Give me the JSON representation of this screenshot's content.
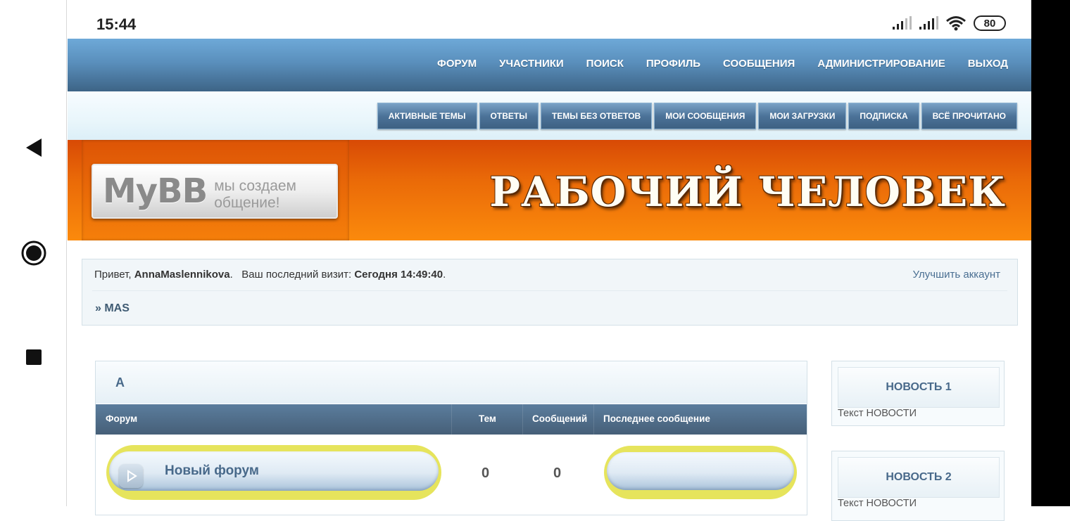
{
  "status_bar": {
    "time": "15:44",
    "battery": "80"
  },
  "main_nav": {
    "items": [
      {
        "label": "ФОРУМ"
      },
      {
        "label": "УЧАСТНИКИ"
      },
      {
        "label": "ПОИСК"
      },
      {
        "label": "ПРОФИЛЬ"
      },
      {
        "label": "СООБЩЕНИЯ"
      },
      {
        "label": "АДМИНИСТРИРОВАНИЕ"
      },
      {
        "label": "ВЫХОД"
      }
    ]
  },
  "sub_nav": {
    "items": [
      {
        "label": "АКТИВНЫЕ ТЕМЫ"
      },
      {
        "label": "ОТВЕТЫ"
      },
      {
        "label": "ТЕМЫ БЕЗ ОТВЕТОВ"
      },
      {
        "label": "МОИ СООБЩЕНИЯ"
      },
      {
        "label": "МОИ ЗАГРУЗКИ"
      },
      {
        "label": "ПОДПИСКА"
      },
      {
        "label": "ВСЁ ПРОЧИТАНО"
      }
    ]
  },
  "banner": {
    "logo_main": "MyBB",
    "logo_tagline": "мы создаем общение!",
    "site_title": "РАБОЧИЙ ЧЕЛОВЕК"
  },
  "welcome": {
    "greeting_prefix": "Привет, ",
    "username": "AnnaMaslennikova",
    "greeting_suffix": ".",
    "last_visit_label": "Ваш последний визит: ",
    "last_visit_value": "Сегодня 14:49:40",
    "last_visit_suffix": ".",
    "upgrade_link": "Улучшить аккаунт",
    "breadcrumb": "» MAS"
  },
  "category": {
    "title": "А",
    "columns": {
      "forum": "Форум",
      "topics": "Тем",
      "posts": "Сообщений",
      "last_post": "Последнее сообщение"
    },
    "forums": [
      {
        "name": "Новый форум",
        "topics": "0",
        "posts": "0"
      }
    ]
  },
  "news": [
    {
      "title": "НОВОСТЬ 1",
      "text": "Текст НОВОСТИ"
    },
    {
      "title": "НОВОСТЬ 2",
      "text": "Текст НОВОСТИ"
    }
  ],
  "colors": {
    "nav_blue": "#5a8fbc",
    "banner_orange": "#ea6a08",
    "pill_yellow": "#e6e45c",
    "link_blue": "#48698a"
  },
  "icons": {
    "back": "back-triangle-icon",
    "home": "home-circle-icon",
    "recent": "recent-square-icon",
    "signal": "signal-icon",
    "wifi": "wifi-icon",
    "forum": "forum-speech-bubble-icon"
  }
}
